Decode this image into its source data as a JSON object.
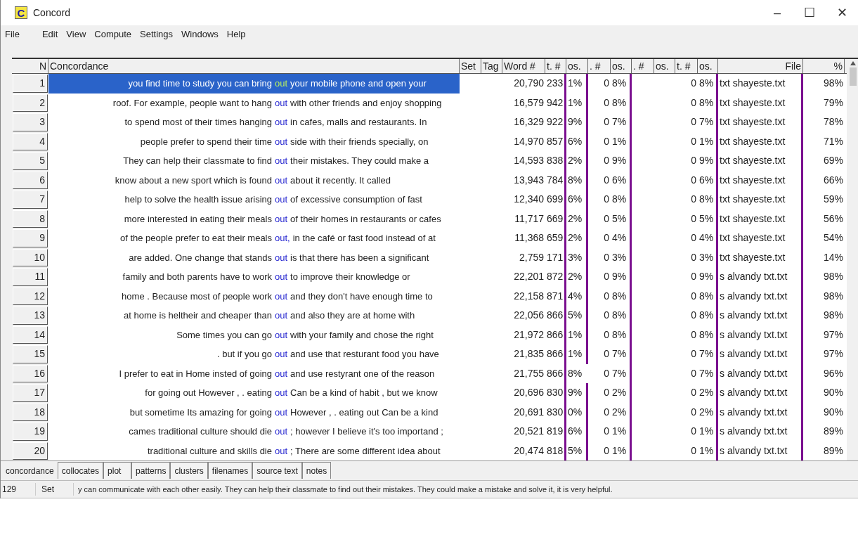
{
  "window": {
    "title": "Concord",
    "icon_letter": "C",
    "controls": [
      "–",
      "☐",
      "✕"
    ]
  },
  "menu": [
    "File",
    "Edit",
    "View",
    "Compute",
    "Settings",
    "Windows",
    "Help"
  ],
  "columns": [
    "N",
    "Concordance",
    "Set",
    "Tag",
    "Word #",
    "t. #",
    "os.",
    ". #",
    "os.",
    ". #",
    "os.",
    "t. #",
    "os.",
    "File",
    "%"
  ],
  "rows": [
    {
      "n": "1",
      "selected": true,
      "left": "you find time to study you can bring",
      "node": "out",
      "right": "your mobile phone and open your",
      "word_no": "20,790",
      "t_no": "233",
      "os1": "1%",
      "p_no": "0",
      "os2": "8%",
      "t_no2": "0",
      "os4": "8%",
      "file": "txt shayeste.txt",
      "pct": "98%",
      "marked": true
    },
    {
      "n": "2",
      "selected": false,
      "left": "roof. For example, people want to hang",
      "node": "out",
      "right": "with other friends and enjoy shopping",
      "word_no": "16,579",
      "t_no": "942",
      "os1": "1%",
      "p_no": "0",
      "os2": "8%",
      "t_no2": "0",
      "os4": "8%",
      "file": "txt shayeste.txt",
      "pct": "79%",
      "marked": true
    },
    {
      "n": "3",
      "selected": false,
      "left": "to spend most of their times hanging",
      "node": "out",
      "right": "in cafes, malls and restaurants. In",
      "word_no": "16,329",
      "t_no": "922",
      "os1": "9%",
      "p_no": "0",
      "os2": "7%",
      "t_no2": "0",
      "os4": "7%",
      "file": "txt shayeste.txt",
      "pct": "78%",
      "marked": true
    },
    {
      "n": "4",
      "selected": false,
      "left": "people prefer to spend their time",
      "node": "out",
      "right": "side with their friends specially, on",
      "word_no": "14,970",
      "t_no": "857",
      "os1": "6%",
      "p_no": "0",
      "os2": "1%",
      "t_no2": "0",
      "os4": "1%",
      "file": "txt shayeste.txt",
      "pct": "71%",
      "marked": true
    },
    {
      "n": "5",
      "selected": false,
      "left": "They can help their classmate to find",
      "node": "out",
      "right": "their mistakes. They could make a",
      "word_no": "14,593",
      "t_no": "838",
      "os1": "2%",
      "p_no": "0",
      "os2": "9%",
      "t_no2": "0",
      "os4": "9%",
      "file": "txt shayeste.txt",
      "pct": "69%",
      "marked": true
    },
    {
      "n": "6",
      "selected": false,
      "left": "know about a new sport which is found",
      "node": "out",
      "right": "about it recently. It called",
      "word_no": "13,943",
      "t_no": "784",
      "os1": "8%",
      "p_no": "0",
      "os2": "6%",
      "t_no2": "0",
      "os4": "6%",
      "file": "txt shayeste.txt",
      "pct": "66%",
      "marked": true
    },
    {
      "n": "7",
      "selected": false,
      "left": "help to solve the health issue arising",
      "node": "out",
      "right": "of excessive consumption of fast",
      "word_no": "12,340",
      "t_no": "699",
      "os1": "6%",
      "p_no": "0",
      "os2": "8%",
      "t_no2": "0",
      "os4": "8%",
      "file": "txt shayeste.txt",
      "pct": "59%",
      "marked": true
    },
    {
      "n": "8",
      "selected": false,
      "left": "more interested in eating their meals",
      "node": "out",
      "right": "of their homes in restaurants or cafes",
      "word_no": "11,717",
      "t_no": "669",
      "os1": "2%",
      "p_no": "0",
      "os2": "5%",
      "t_no2": "0",
      "os4": "5%",
      "file": "txt shayeste.txt",
      "pct": "56%",
      "marked": true
    },
    {
      "n": "9",
      "selected": false,
      "left": "of the people prefer to eat their meals",
      "node": "out,",
      "right": "in the café or fast food instead of at",
      "word_no": "11,368",
      "t_no": "659",
      "os1": "2%",
      "p_no": "0",
      "os2": "4%",
      "t_no2": "0",
      "os4": "4%",
      "file": "txt shayeste.txt",
      "pct": "54%",
      "marked": true
    },
    {
      "n": "10",
      "selected": false,
      "left": "are added. One change that stands",
      "node": "out",
      "right": "is that there has been a significant",
      "word_no": "2,759",
      "t_no": "171",
      "os1": "3%",
      "p_no": "0",
      "os2": "3%",
      "t_no2": "0",
      "os4": "3%",
      "file": "txt shayeste.txt",
      "pct": "14%",
      "marked": true
    },
    {
      "n": "11",
      "selected": false,
      "left": "family and both parents have to work",
      "node": "out",
      "right": "to improve their knowledge or",
      "word_no": "22,201",
      "t_no": "872",
      "os1": "2%",
      "p_no": "0",
      "os2": "9%",
      "t_no2": "0",
      "os4": "9%",
      "file": "s alvandy txt.txt",
      "pct": "98%",
      "marked": true
    },
    {
      "n": "12",
      "selected": false,
      "left": "home . Because most of people work",
      "node": "out",
      "right": "and they don't have enough time to",
      "word_no": "22,158",
      "t_no": "871",
      "os1": "4%",
      "p_no": "0",
      "os2": "8%",
      "t_no2": "0",
      "os4": "8%",
      "file": "s alvandy txt.txt",
      "pct": "98%",
      "marked": true
    },
    {
      "n": "13",
      "selected": false,
      "left": "at home is heltheir and cheaper than",
      "node": "out",
      "right": "and also they are at home with",
      "word_no": "22,056",
      "t_no": "866",
      "os1": "5%",
      "p_no": "0",
      "os2": "8%",
      "t_no2": "0",
      "os4": "8%",
      "file": "s alvandy txt.txt",
      "pct": "98%",
      "marked": true
    },
    {
      "n": "14",
      "selected": false,
      "left": "Some times you can go",
      "node": "out",
      "right": "with your family and chose the right",
      "word_no": "21,972",
      "t_no": "866",
      "os1": "1%",
      "p_no": "0",
      "os2": "8%",
      "t_no2": "0",
      "os4": "8%",
      "file": "s alvandy txt.txt",
      "pct": "97%",
      "marked": true
    },
    {
      "n": "15",
      "selected": false,
      "left": ". but if you go",
      "node": "out",
      "right": "and use that resturant food you have",
      "word_no": "21,835",
      "t_no": "866",
      "os1": "1%",
      "p_no": "0",
      "os2": "7%",
      "t_no2": "0",
      "os4": "7%",
      "file": "s alvandy txt.txt",
      "pct": "97%",
      "marked": true
    },
    {
      "n": "16",
      "selected": false,
      "left": "I prefer to eat in Home insted of going",
      "node": "out",
      "right": "and use restyrant one of the reason",
      "word_no": "21,755",
      "t_no": "866",
      "os1": "8%",
      "p_no": "0",
      "os2": "7%",
      "t_no2": "0",
      "os4": "7%",
      "file": "s alvandy txt.txt",
      "pct": "96%",
      "marked": false
    },
    {
      "n": "17",
      "selected": false,
      "left": "for going out However , . eating",
      "node": "out",
      "right": "Can be a kind of habit , but we know",
      "word_no": "20,696",
      "t_no": "830",
      "os1": "9%",
      "p_no": "0",
      "os2": "2%",
      "t_no2": "0",
      "os4": "2%",
      "file": "s alvandy txt.txt",
      "pct": "90%",
      "marked": true
    },
    {
      "n": "18",
      "selected": false,
      "left": "but sometime Its amazing for going",
      "node": "out",
      "right": "However , . eating out Can be a kind",
      "word_no": "20,691",
      "t_no": "830",
      "os1": "0%",
      "p_no": "0",
      "os2": "2%",
      "t_no2": "0",
      "os4": "2%",
      "file": "s alvandy txt.txt",
      "pct": "90%",
      "marked": true
    },
    {
      "n": "19",
      "selected": false,
      "left": "cames traditional culture should die",
      "node": "out",
      "right": "; however I believe it's too importand ;",
      "word_no": "20,521",
      "t_no": "819",
      "os1": "6%",
      "p_no": "0",
      "os2": "1%",
      "t_no2": "0",
      "os4": "1%",
      "file": "s alvandy txt.txt",
      "pct": "89%",
      "marked": true
    },
    {
      "n": "20",
      "selected": false,
      "left": "traditional culture and skills die",
      "node": "out",
      "right": "; There are some different idea about",
      "word_no": "20,474",
      "t_no": "818",
      "os1": "5%",
      "p_no": "0",
      "os2": "1%",
      "t_no2": "0",
      "os4": "1%",
      "file": "s alvandy txt.txt",
      "pct": "89%",
      "marked": true
    }
  ],
  "tabs": [
    {
      "label": "concordance",
      "selected": true
    },
    {
      "label": "collocates",
      "selected": false
    },
    {
      "label": "plot",
      "selected": false
    },
    {
      "label": "patterns",
      "selected": false
    },
    {
      "label": "clusters",
      "selected": false
    },
    {
      "label": "filenames",
      "selected": false
    },
    {
      "label": "source text",
      "selected": false
    },
    {
      "label": "notes",
      "selected": false
    }
  ],
  "status_bar": {
    "count": "129",
    "set": "Set",
    "text": "y can communicate with each other easily. They can help their classmate to find out their mistakes. They could make a mistake and solve it, it is very helpful."
  }
}
